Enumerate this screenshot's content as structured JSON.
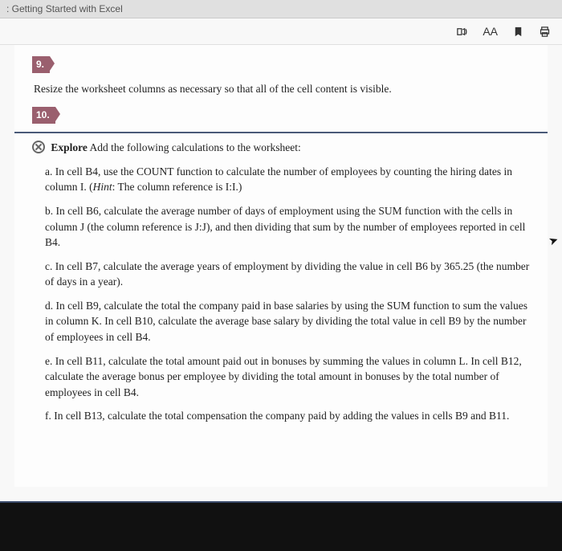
{
  "topbar": {
    "title": ": Getting Started with Excel"
  },
  "toolbar": {
    "immersive_icon": "immersive-reader-icon",
    "text_size_label": "AA",
    "bookmark_icon": "bookmark-icon",
    "print_icon": "print-icon"
  },
  "step9": {
    "number": "9.",
    "text": "Resize the worksheet columns as necessary so that all of the cell content is visible."
  },
  "step10": {
    "number": "10.",
    "explore_label": "Explore",
    "intro": " Add the following calculations to the worksheet:",
    "items": {
      "a": {
        "letter": "a.",
        "text": " In cell B4, use the COUNT function to calculate the number of employees by counting the hiring dates in column I. (",
        "hint_label": "Hint",
        "hint_rest": ": The column reference is I:I.)"
      },
      "b": {
        "letter": "b.",
        "text": " In cell B6, calculate the average number of days of employment using the SUM function with the cells in column J (the column reference is J:J), and then dividing that sum by the number of employees reported in cell B4."
      },
      "c": {
        "letter": "c.",
        "text": " In cell B7, calculate the average years of employment by dividing the value in cell B6 by 365.25 (the number of days in a year)."
      },
      "d": {
        "letter": "d.",
        "text": " In cell B9, calculate the total the company paid in base salaries by using the SUM function to sum the values in column K. In cell B10, calculate the average base salary by dividing the total value in cell B9 by the number of employees in cell B4."
      },
      "e": {
        "letter": "e.",
        "text": " In cell B11, calculate the total amount paid out in bonuses by summing the values in column L. In cell B12, calculate the average bonus per employee by dividing the total amount in bonuses by the total number of employees in cell B4."
      },
      "f": {
        "letter": "f.",
        "text": " In cell B13, calculate the total compensation the company paid by adding the values in cells B9 and B11."
      }
    }
  }
}
